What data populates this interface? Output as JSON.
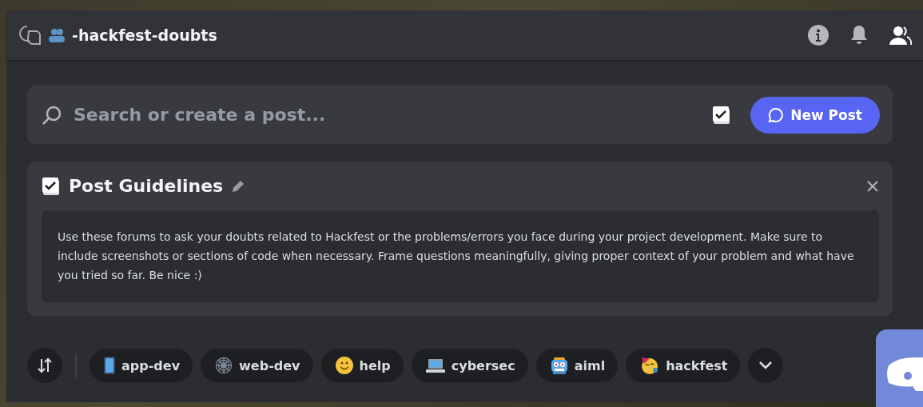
{
  "header": {
    "channel_name": "-hackfest-doubts"
  },
  "search": {
    "placeholder": "Search or create a post..."
  },
  "new_post_button": {
    "label": "New Post"
  },
  "guidelines": {
    "title": "Post Guidelines",
    "text": "Use these forums to ask your doubts related to Hackfest or the problems/errors you face during your project development. Make sure to include screenshots or sections of code when necessary. Frame questions meaningfully, giving proper context of your problem and what have you tried so far. Be nice :)"
  },
  "tags": [
    {
      "label": "app-dev",
      "selected": false
    },
    {
      "label": "web-dev",
      "selected": false
    },
    {
      "label": "help",
      "selected": false
    },
    {
      "label": "cybersec",
      "selected": false
    },
    {
      "label": "aiml",
      "selected": false
    },
    {
      "label": "hackfest",
      "selected": false
    }
  ]
}
